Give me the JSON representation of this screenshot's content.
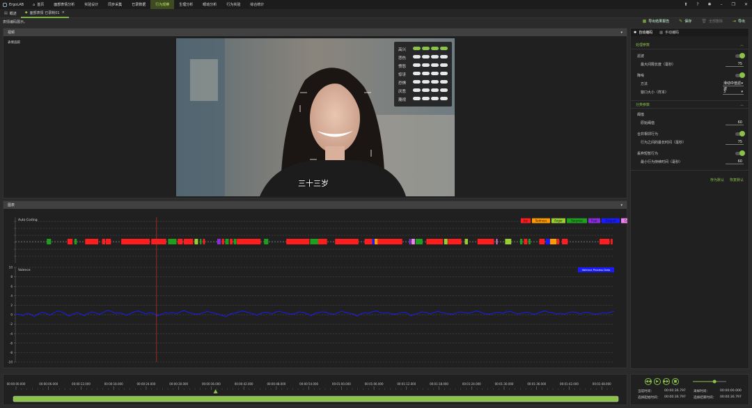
{
  "app": {
    "name": "ErgoLAB"
  },
  "menu": [
    {
      "label": "首页",
      "icon": "home-icon"
    },
    {
      "label": "面部表情分析",
      "icon": ""
    },
    {
      "label": "实验设计",
      "icon": ""
    },
    {
      "label": "同步采集",
      "icon": ""
    },
    {
      "label": "已录数据",
      "icon": ""
    },
    {
      "label": "行为观察",
      "icon": "",
      "active": true
    },
    {
      "label": "生理分析",
      "icon": ""
    },
    {
      "label": "眼动分析",
      "icon": ""
    },
    {
      "label": "行为实验",
      "icon": ""
    },
    {
      "label": "综合统计",
      "icon": ""
    }
  ],
  "tabs": [
    {
      "label": "概述"
    },
    {
      "label": "面部表情 已录制01"
    }
  ],
  "breadcrumb": "表情编码展示。",
  "toolbar": {
    "report": "导出结果报告",
    "save": "保存",
    "delete": "全部删除",
    "export": "导出"
  },
  "video_panel": {
    "title": "视频",
    "subtitle": "表情追踪"
  },
  "emotions": [
    {
      "label": "高兴",
      "level": 4
    },
    {
      "label": "悲伤",
      "level": 0
    },
    {
      "label": "愤怒",
      "level": 0
    },
    {
      "label": "惊讶",
      "level": 0
    },
    {
      "label": "恐惧",
      "level": 0
    },
    {
      "label": "厌恶",
      "level": 0
    },
    {
      "label": "蔑视",
      "level": 0
    }
  ],
  "video_caption": "三十三岁",
  "chart_panel": {
    "title": "图表"
  },
  "chart_data": [
    {
      "type": "timeline",
      "title": "Auto Coding",
      "legend": [
        {
          "name": "Joy",
          "color": "#ff1d1d"
        },
        {
          "name": "Sadness",
          "color": "#ff9a00"
        },
        {
          "name": "Anger",
          "color": "#9acd32"
        },
        {
          "name": "Surprise",
          "color": "#1ea01e"
        },
        {
          "name": "Fear",
          "color": "#8a2be2"
        },
        {
          "name": "Disgust",
          "color": "#1a1aff"
        },
        {
          "name": "Contempt",
          "color": "#ee82ee"
        }
      ],
      "legend_position": "top-right",
      "x_range_seconds": [
        0,
        156
      ],
      "segments": [
        {
          "s": 8.2,
          "e": 9.3,
          "c": 3
        },
        {
          "s": 13.6,
          "e": 14.9,
          "c": 0
        },
        {
          "s": 15.4,
          "e": 16.0,
          "c": 3
        },
        {
          "s": 18.2,
          "e": 21.6,
          "c": 0
        },
        {
          "s": 22.6,
          "e": 23.4,
          "c": 0
        },
        {
          "s": 23.6,
          "e": 24.9,
          "c": 0
        },
        {
          "s": 27.6,
          "e": 35.0,
          "c": 0
        },
        {
          "s": 35.4,
          "e": 39.3,
          "c": 0
        },
        {
          "s": 39.8,
          "e": 42.0,
          "c": 3
        },
        {
          "s": 42.3,
          "e": 43.6,
          "c": 0
        },
        {
          "s": 43.9,
          "e": 46.3,
          "c": 0
        },
        {
          "s": 46.7,
          "e": 47.6,
          "c": 2
        },
        {
          "s": 48.1,
          "e": 48.5,
          "c": 3
        },
        {
          "s": 48.9,
          "e": 49.4,
          "c": 0
        },
        {
          "s": 52.6,
          "e": 53.5,
          "c": 4
        },
        {
          "s": 53.8,
          "e": 54.4,
          "c": 0
        },
        {
          "s": 54.7,
          "e": 55.6,
          "c": 3
        },
        {
          "s": 55.9,
          "e": 56.6,
          "c": 0
        },
        {
          "s": 56.9,
          "e": 57.6,
          "c": 3
        },
        {
          "s": 57.7,
          "e": 63.9,
          "c": 0
        },
        {
          "s": 64.8,
          "e": 65.9,
          "c": 3
        },
        {
          "s": 70.6,
          "e": 76.6,
          "c": 0
        },
        {
          "s": 76.8,
          "e": 78.9,
          "c": 3
        },
        {
          "s": 78.9,
          "e": 81.2,
          "c": 0
        },
        {
          "s": 83.3,
          "e": 89.4,
          "c": 0
        },
        {
          "s": 91.0,
          "e": 93.0,
          "c": 0
        },
        {
          "s": 93.0,
          "e": 93.6,
          "c": 5
        },
        {
          "s": 93.6,
          "e": 94.4,
          "c": 1
        },
        {
          "s": 94.4,
          "e": 100.8,
          "c": 0
        },
        {
          "s": 102.6,
          "e": 103.0,
          "c": 4
        },
        {
          "s": 103.2,
          "e": 104.1,
          "c": 6
        },
        {
          "s": 104.3,
          "e": 106.1,
          "c": 3
        },
        {
          "s": 107.1,
          "e": 107.7,
          "c": 0
        },
        {
          "s": 107.7,
          "e": 111.4,
          "c": 0
        },
        {
          "s": 111.7,
          "e": 112.6,
          "c": 2
        },
        {
          "s": 112.7,
          "e": 116.2,
          "c": 0
        },
        {
          "s": 117.1,
          "e": 117.9,
          "c": 2
        },
        {
          "s": 120.4,
          "e": 124.7,
          "c": 0
        },
        {
          "s": 125.3,
          "e": 125.6,
          "c": 6
        },
        {
          "s": 127.6,
          "e": 129.2,
          "c": 2
        },
        {
          "s": 131.5,
          "e": 132.1,
          "c": 3
        },
        {
          "s": 132.5,
          "e": 133.4,
          "c": 0
        },
        {
          "s": 133.7,
          "e": 134.2,
          "c": 3
        },
        {
          "s": 136.5,
          "e": 137.9,
          "c": 0
        },
        {
          "s": 138.2,
          "e": 139.3,
          "c": 5
        },
        {
          "s": 139.3,
          "e": 141.0,
          "c": 1
        },
        {
          "s": 141.1,
          "e": 141.7,
          "c": 0
        },
        {
          "s": 142.4,
          "e": 143.9,
          "c": 0
        },
        {
          "s": 152.2,
          "e": 154.8,
          "c": 0
        },
        {
          "s": 155.1,
          "e": 155.6,
          "c": 0
        }
      ]
    },
    {
      "type": "line",
      "title": "Valence",
      "series": [
        {
          "name": "Valence Process Data",
          "color": "#1a1aff"
        }
      ],
      "legend_position": "top-right",
      "ylim": [
        -10,
        10
      ],
      "yticks": [
        10,
        8,
        6,
        4,
        2,
        0,
        -2,
        -4,
        -6,
        -8,
        -10
      ],
      "xlim_seconds": [
        0,
        156
      ],
      "y": [
        0,
        0.1,
        -0.2,
        0.3,
        0.1,
        -0.4,
        0.2,
        0.5,
        0.3,
        -0.1,
        0.4,
        0.8,
        0.6,
        0.2,
        -0.3,
        0.1,
        0.4,
        0.2,
        -0.2,
        0.3,
        0.6,
        0.4,
        0.1,
        0.5,
        0.9,
        0.7,
        0.3,
        0.4,
        0.2,
        -0.1,
        0.3,
        0.6,
        0.8,
        0.5,
        0.2,
        0.4,
        0.3,
        -0.2,
        0.1,
        0.4,
        0.3,
        0.5,
        0.2,
        0.6,
        0.9,
        0.5,
        0.3,
        0.1,
        0.2,
        0.4,
        0.7,
        0.5,
        0.3,
        0.1,
        -0.2,
        -0.4,
        0.2,
        0.3,
        0.5,
        0.8,
        0.6,
        0.4,
        0.2,
        -0.1,
        0.3,
        0.5,
        0.4,
        0.2,
        0.6,
        0.7,
        0.4,
        0.3,
        0.1,
        0.3,
        0.6,
        0.5,
        0.2,
        -0.2,
        0.3,
        0.4,
        0.6,
        0.5,
        0.2,
        0.1,
        0.4,
        0.7,
        0.5,
        0.3,
        0.2,
        -0.3,
        0.2,
        0.4,
        0.3,
        0.6,
        0.8,
        0.5,
        0.3,
        0.4,
        0.2,
        0.1,
        0.3,
        0.5,
        0.4,
        -0.2,
        0.1,
        0.3,
        0.6,
        0.5,
        0.2,
        0.4,
        0.7,
        0.5,
        0.3,
        0.2,
        0.1,
        0.4,
        0.6,
        0.4,
        0.3,
        0.5,
        0.8,
        0.6,
        0.3,
        0.1,
        0.2,
        0.4,
        0.5,
        0.3,
        0.6,
        0.7,
        0.4,
        0.2,
        0.3,
        0.5,
        0.4,
        0.1,
        0.3,
        0.6,
        0.8,
        0.5,
        0.4,
        0.2,
        0.3,
        0.1,
        0.4,
        0.6,
        0.5,
        0.2,
        0.4,
        0.5,
        0.3,
        0.1,
        0.2,
        0.4,
        0.3,
        0.5,
        0.7
      ]
    }
  ],
  "playhead_seconds": 36.797,
  "timeline": {
    "ticks": [
      "00:00:00.000",
      "00:00:06.000",
      "00:00:12.000",
      "00:00:18.000",
      "00:00:24.000",
      "00:00:30.000",
      "00:00:36.000",
      "00:00:42.000",
      "00:00:48.000",
      "00:00:54.000",
      "00:01:00.000",
      "00:01:06.000",
      "00:01:12.000",
      "00:01:18.000",
      "00:01:24.000",
      "00:01:30.000",
      "00:01:36.000",
      "00:01:42.000",
      "00:01:48.000"
    ]
  },
  "right_panel": {
    "tabs": [
      "自动编码",
      "手动编码"
    ],
    "sections": {
      "processing": "处理参数",
      "filter": "滤波",
      "max_gap": "最大间隔长度（毫秒）",
      "max_gap_val": "75",
      "smooth": "降噪",
      "method": "方法",
      "method_val": "滑动中值滤波",
      "window": "窗口大小（样本）",
      "window_val": "3",
      "classify": "分类参数",
      "threshold": "阈值",
      "threshold_label": "原始阈值",
      "threshold_val": "60",
      "merge": "合并相邻行为",
      "merge_gap": "行为之间的最长时间（毫秒）",
      "merge_gap_val": "75",
      "discard": "丢弃短暂行为",
      "min_dur": "最小行为持续时间（毫秒）",
      "min_dur_val": "60",
      "save_default": "存为默认",
      "restore_default": "恢复默认"
    }
  },
  "playback": {
    "current_label": "当前时间：",
    "current": "00:00:36.797",
    "start_label": "选择起始时间：",
    "start": "00:00:36.797",
    "rate_label": "采样时间：",
    "rate": "00:00:00.000",
    "end_label": "选择结束时间：",
    "end": "00:00:36.797",
    "volume": 0.65
  }
}
